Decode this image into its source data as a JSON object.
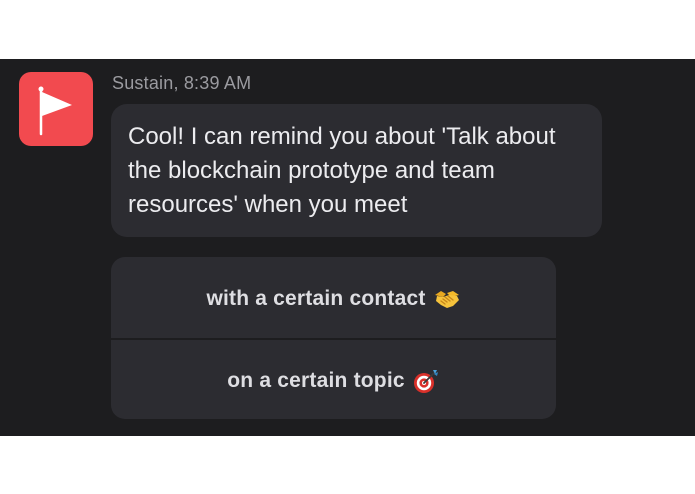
{
  "message": {
    "sender": "Sustain",
    "time": "8:39 AM",
    "meta": "Sustain, 8:39 AM",
    "text": "Cool! I can remind you about 'Talk about the blockchain prototype and team resources' when you meet"
  },
  "avatar": {
    "icon": "flag-icon",
    "color": "#f24a4f"
  },
  "options": [
    {
      "label": "with a certain contact",
      "icon": "handshake-icon"
    },
    {
      "label": "on a certain topic",
      "icon": "direct-hit-target-icon"
    }
  ],
  "colors": {
    "background": "#1d1d1f",
    "bubble": "#2c2c31",
    "text": "#ececef",
    "meta": "#9b9ba0"
  }
}
